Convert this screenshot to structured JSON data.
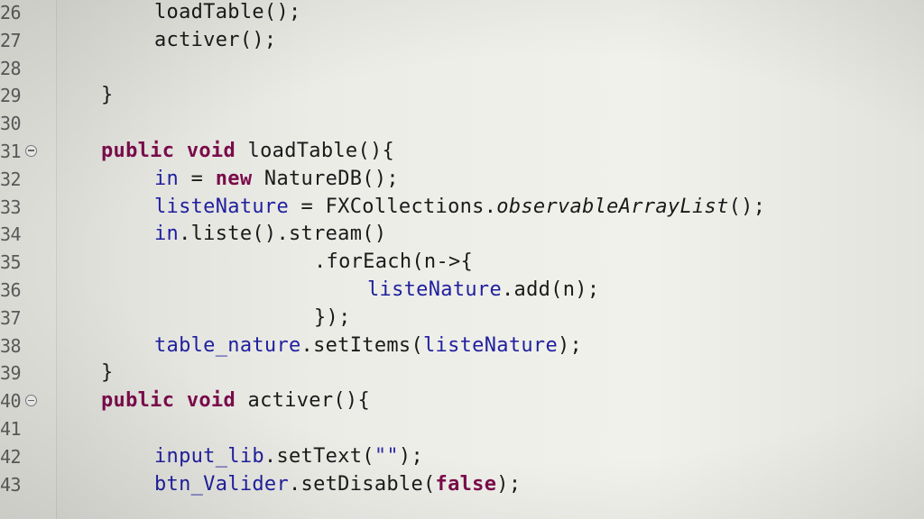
{
  "editor": {
    "lines": [
      {
        "number": "26",
        "fold": false,
        "indent": 1,
        "tokens": [
          {
            "t": "loadTable();",
            "c": "plain"
          }
        ]
      },
      {
        "number": "27",
        "fold": false,
        "indent": 1,
        "tokens": [
          {
            "t": "activer();",
            "c": "plain"
          }
        ]
      },
      {
        "number": "28",
        "fold": false,
        "indent": 0,
        "tokens": []
      },
      {
        "number": "29",
        "fold": false,
        "indent": 0,
        "tokens": [
          {
            "t": "}",
            "c": "plain"
          }
        ]
      },
      {
        "number": "30",
        "fold": false,
        "indent": 0,
        "tokens": []
      },
      {
        "number": "31",
        "fold": true,
        "indent": 0,
        "tokens": [
          {
            "t": "public",
            "c": "kw"
          },
          {
            "t": " ",
            "c": "plain"
          },
          {
            "t": "void",
            "c": "kw"
          },
          {
            "t": " loadTable(){",
            "c": "plain"
          }
        ]
      },
      {
        "number": "32",
        "fold": false,
        "indent": 1,
        "tokens": [
          {
            "t": "in",
            "c": "fld"
          },
          {
            "t": " = ",
            "c": "plain"
          },
          {
            "t": "new",
            "c": "kw"
          },
          {
            "t": " NatureDB();",
            "c": "plain"
          }
        ]
      },
      {
        "number": "33",
        "fold": false,
        "indent": 1,
        "tokens": [
          {
            "t": "listeNature",
            "c": "fld"
          },
          {
            "t": " = FXCollections.",
            "c": "plain"
          },
          {
            "t": "observableArrayList",
            "c": "it"
          },
          {
            "t": "();",
            "c": "plain"
          }
        ]
      },
      {
        "number": "34",
        "fold": false,
        "indent": 1,
        "tokens": [
          {
            "t": "in",
            "c": "fld"
          },
          {
            "t": ".liste().stream()",
            "c": "plain"
          }
        ]
      },
      {
        "number": "35",
        "fold": false,
        "indent": 4,
        "tokens": [
          {
            "t": ".forEach(n->{",
            "c": "plain"
          }
        ]
      },
      {
        "number": "36",
        "fold": false,
        "indent": 5,
        "tokens": [
          {
            "t": "listeNature",
            "c": "fld"
          },
          {
            "t": ".add(n);",
            "c": "plain"
          }
        ]
      },
      {
        "number": "37",
        "fold": false,
        "indent": 4,
        "tokens": [
          {
            "t": "});",
            "c": "plain"
          }
        ]
      },
      {
        "number": "38",
        "fold": false,
        "indent": 1,
        "tokens": [
          {
            "t": "table_nature",
            "c": "fld"
          },
          {
            "t": ".setItems(",
            "c": "plain"
          },
          {
            "t": "listeNature",
            "c": "fld"
          },
          {
            "t": ");",
            "c": "plain"
          }
        ]
      },
      {
        "number": "39",
        "fold": false,
        "indent": 0,
        "tokens": [
          {
            "t": "}",
            "c": "plain"
          }
        ]
      },
      {
        "number": "40",
        "fold": true,
        "indent": 0,
        "tokens": [
          {
            "t": "public",
            "c": "kw"
          },
          {
            "t": " ",
            "c": "plain"
          },
          {
            "t": "void",
            "c": "kw"
          },
          {
            "t": " activer(){",
            "c": "plain"
          }
        ]
      },
      {
        "number": "41",
        "fold": false,
        "indent": 0,
        "tokens": []
      },
      {
        "number": "42",
        "fold": false,
        "indent": 1,
        "tokens": [
          {
            "t": "input_lib",
            "c": "fld"
          },
          {
            "t": ".setText(",
            "c": "plain"
          },
          {
            "t": "\"\"",
            "c": "str"
          },
          {
            "t": ");",
            "c": "plain"
          }
        ]
      },
      {
        "number": "43",
        "fold": false,
        "indent": 1,
        "tokens": [
          {
            "t": "btn_Valider",
            "c": "fld"
          },
          {
            "t": ".setDisable(",
            "c": "plain"
          },
          {
            "t": "false",
            "c": "kw"
          },
          {
            "t": ");",
            "c": "plain"
          }
        ]
      }
    ]
  }
}
